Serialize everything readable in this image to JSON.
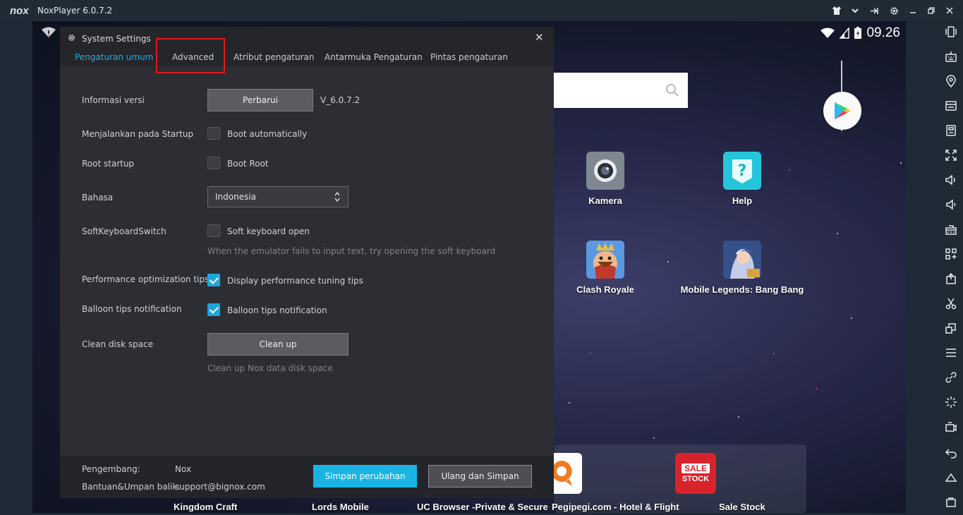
{
  "window": {
    "logo": "nox",
    "title": "NoxPlayer 6.0.7.2"
  },
  "status": {
    "time": "09.26"
  },
  "apps": [
    {
      "label": "Kamera",
      "icon": "camera-icon"
    },
    {
      "label": "Help",
      "icon": "help-icon"
    },
    {
      "label": "Clash Royale",
      "icon": "clash-royale-icon"
    },
    {
      "label": "Mobile Legends: Bang Bang",
      "icon": "mobile-legends-icon"
    }
  ],
  "dock": [
    {
      "label": "Kingdom Craft"
    },
    {
      "label": "Lords Mobile"
    },
    {
      "label": "UC Browser -Private & Secure"
    },
    {
      "label": "Pegipegi.com - Hotel & Flight"
    },
    {
      "label": "Sale Stock",
      "badge_top": "SALE",
      "badge_bottom": "STOCK"
    }
  ],
  "dialog": {
    "title": "System Settings",
    "tabs": [
      "Pengaturan umum",
      "Advanced",
      "Atribut pengaturan",
      "Antarmuka Pengaturan",
      "Pintas pengaturan"
    ],
    "active_tab": "Pengaturan umum",
    "highlighted_tab": "Advanced",
    "version": {
      "label": "Informasi versi",
      "button": "Perbarui",
      "value": "V_6.0.7.2"
    },
    "startup": {
      "label": "Menjalankan pada Startup",
      "option": "Boot automatically",
      "checked": false
    },
    "root": {
      "label": "Root startup",
      "option": "Boot Root",
      "checked": false
    },
    "language": {
      "label": "Bahasa",
      "value": "Indonesia"
    },
    "softkeyboard": {
      "label": "SoftKeyboardSwitch",
      "option": "Soft keyboard open",
      "checked": false,
      "hint": "When the emulator fails to input text, try opening the soft keyboard"
    },
    "perf": {
      "label": "Performance optimization tips",
      "option": "Display performance tuning tips",
      "checked": true
    },
    "balloon": {
      "label": "Balloon tips notification",
      "option": "Balloon tips notification",
      "checked": true
    },
    "disk": {
      "label": "Clean disk space",
      "button": "Clean up",
      "hint": "Clean up Nox data disk space"
    },
    "footer": {
      "dev_label": "Pengembang:",
      "dev_value": "Nox",
      "help_label": "Bantuan&Umpan balik:",
      "help_value": "support@bignox.com",
      "save": "Simpan perubahan",
      "reset": "Ulang dan Simpan"
    }
  },
  "colors": {
    "accent": "#19b4e4",
    "highlight": "#e5161b",
    "dialog_bg": "#2d2e33"
  }
}
